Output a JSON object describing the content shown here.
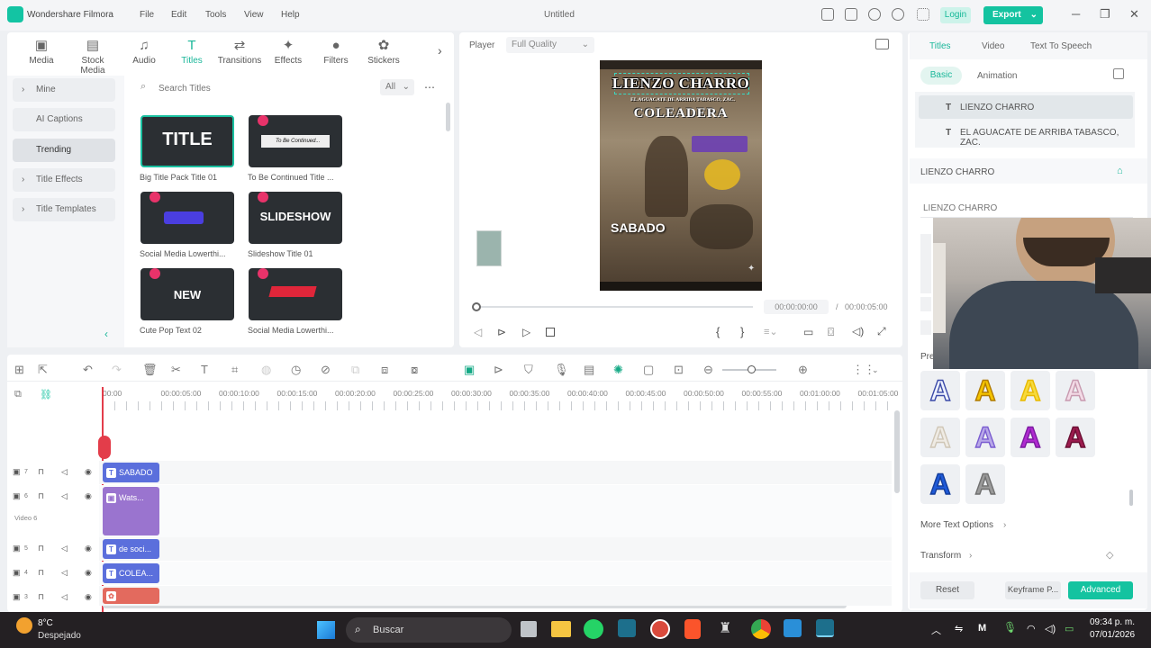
{
  "app": {
    "name": "Wondershare Filmora",
    "doc_title": "Untitled"
  },
  "menu": [
    "File",
    "Edit",
    "Tools",
    "View",
    "Help"
  ],
  "header_buttons": {
    "login": "Login",
    "export": "Export"
  },
  "toolbar": [
    {
      "label": "Media",
      "icon": "image-icon"
    },
    {
      "label": "Stock Media",
      "icon": "film-icon"
    },
    {
      "label": "Audio",
      "icon": "music-icon"
    },
    {
      "label": "Titles",
      "icon": "text-icon",
      "active": true
    },
    {
      "label": "Transitions",
      "icon": "transition-icon"
    },
    {
      "label": "Effects",
      "icon": "effects-icon"
    },
    {
      "label": "Filters",
      "icon": "filters-icon"
    },
    {
      "label": "Stickers",
      "icon": "stickers-icon"
    }
  ],
  "sidebar": [
    {
      "label": "Mine",
      "arrow": "›"
    },
    {
      "label": "AI Captions",
      "arrow": ""
    },
    {
      "label": "Trending",
      "arrow": "",
      "active": true
    },
    {
      "label": "Title Effects",
      "arrow": "›"
    },
    {
      "label": "Title Templates",
      "arrow": "›"
    }
  ],
  "search": {
    "placeholder": "Search Titles",
    "filter": "All"
  },
  "titles": [
    {
      "label": "Big Title Pack Title 01",
      "thumb_text": "TITLE",
      "premium": false
    },
    {
      "label": "To Be Continued Title ...",
      "thumb_text": "To Be Continued...",
      "premium": true
    },
    {
      "label": "Social Media Lowerthi...",
      "thumb_text": "",
      "premium": true
    },
    {
      "label": "Slideshow Title 01",
      "thumb_text": "SLIDESHOW",
      "premium": true
    },
    {
      "label": "Cute Pop Text 02",
      "thumb_text": "NEW",
      "premium": true
    },
    {
      "label": "Social Media Lowerthi...",
      "thumb_text": "",
      "premium": true
    }
  ],
  "player": {
    "label": "Player",
    "quality": "Full Quality",
    "current_time": "00:00:00:00",
    "total_time": "00:00:05:00",
    "progress": 0,
    "preview_texts": [
      "LIENZO CHARRO",
      "EL AGUACATE DE ARRIBA TABASCO, ZAC.",
      "COLEADERA",
      "SABADO"
    ]
  },
  "right_panel": {
    "tabs": [
      "Titles",
      "Video",
      "Text To Speech"
    ],
    "subtabs": [
      "Basic",
      "Animation"
    ],
    "layers": [
      "LIENZO CHARRO",
      "EL AGUACATE DE ARRIBA TABASCO, ZAC."
    ],
    "section_title": "LIENZO CHARRO",
    "text_value": "LIENZO CHARRO",
    "preset_label": "Pre",
    "more_options": "More Text Options",
    "transform": "Transform",
    "buttons": {
      "reset": "Reset",
      "keyframe": "Keyframe P...",
      "advanced": "Advanced"
    },
    "presets": [
      {
        "fill": "#eef2ff",
        "stroke": "#3b4aa8"
      },
      {
        "fill": "#f4c400",
        "stroke": "#b07a00"
      },
      {
        "fill": "#f7da3c",
        "stroke": "#e8b900"
      },
      {
        "fill": "#f3dbe6",
        "stroke": "#c89ab0"
      },
      {
        "fill": "#efebe4",
        "stroke": "#cfc6b6"
      },
      {
        "fill": "#b8a8e8",
        "stroke": "#7a5cd0"
      },
      {
        "fill": "#b02ad0",
        "stroke": "#7a1ba0"
      },
      {
        "fill": "#9c1b4e",
        "stroke": "#6a0f33"
      },
      {
        "fill": "#1f5ad8",
        "stroke": "#143d9a"
      },
      {
        "fill": "#9a9a9a",
        "stroke": "#707070"
      }
    ]
  },
  "timeline": {
    "ruler": [
      "00:00",
      "00:00:05:00",
      "00:00:10:00",
      "00:00:15:00",
      "00:00:20:00",
      "00:00:25:00",
      "00:00:30:00",
      "00:00:35:00",
      "00:00:40:00",
      "00:00:45:00",
      "00:00:50:00",
      "00:00:55:00",
      "00:01:00:00",
      "00:01:05:00"
    ],
    "tracks": [
      {
        "num": "7",
        "clip": "SABADO",
        "color": "#5b6fdc",
        "kind": "text"
      },
      {
        "num": "6",
        "clip": "Wats...",
        "color": "#9a74cf",
        "kind": "video",
        "sub": "Video 6"
      },
      {
        "num": "5",
        "clip": "de soci...",
        "color": "#5b6fdc",
        "kind": "text"
      },
      {
        "num": "4",
        "clip": "COLEA...",
        "color": "#5b6fdc",
        "kind": "text"
      },
      {
        "num": "3",
        "clip": "",
        "color": "#e36a5e",
        "kind": "sticker"
      }
    ]
  },
  "taskbar": {
    "temp": "8°C",
    "weather": "Despejado",
    "search": "Buscar",
    "time": "09:34 p. m.",
    "date": "07/01/2026"
  }
}
